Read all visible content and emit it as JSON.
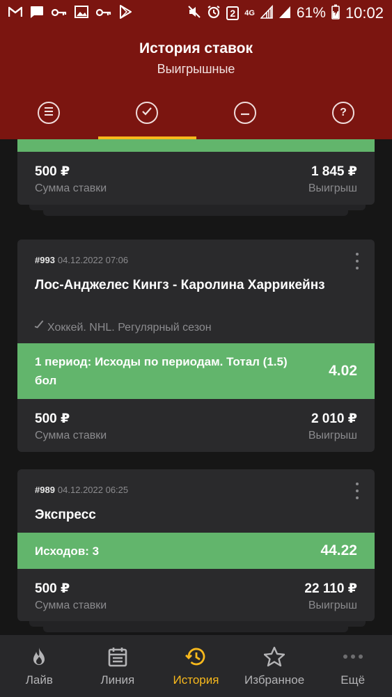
{
  "status_bar": {
    "battery": "61%",
    "time": "10:02",
    "notification_count": "2",
    "network": "4G"
  },
  "header": {
    "title": "История ставок",
    "subtitle": "Выигрышные"
  },
  "filter_tabs": [
    {
      "icon": "list-icon",
      "active": false
    },
    {
      "icon": "check-circle-icon",
      "active": true
    },
    {
      "icon": "minus-circle-icon",
      "active": false
    },
    {
      "icon": "question-circle-icon",
      "active": false
    }
  ],
  "cards": [
    {
      "amount": "500 ₽",
      "amount_label": "Сумма ставки",
      "win": "1 845 ₽",
      "win_label": "Выигрыш"
    },
    {
      "id": "#993",
      "date": "04.12.2022 07:06",
      "match": "Лос-Анджелес Кингз - Каролина Харрикейнз",
      "sport": "Хоккей. NHL. Регулярный сезон",
      "market": "1 период: Исходы по периодам. Тотал (1.5) бол",
      "odds": "4.02",
      "amount": "500 ₽",
      "amount_label": "Сумма ставки",
      "win": "2 010 ₽",
      "win_label": "Выигрыш"
    },
    {
      "id": "#989",
      "date": "04.12.2022 06:25",
      "match": "Экспресс",
      "market": "Исходов: 3",
      "odds": "44.22",
      "amount": "500 ₽",
      "amount_label": "Сумма ставки",
      "win": "22 110 ₽",
      "win_label": "Выигрыш"
    }
  ],
  "bottom_nav": [
    {
      "label": "Лайв",
      "icon": "flame-icon",
      "active": false
    },
    {
      "label": "Линия",
      "icon": "calendar-icon",
      "active": false
    },
    {
      "label": "История",
      "icon": "history-icon",
      "active": true
    },
    {
      "label": "Избранное",
      "icon": "star-icon",
      "active": false
    },
    {
      "label": "Ещё",
      "icon": "more-dots-icon",
      "active": false
    }
  ],
  "colors": {
    "header": "#7b1510",
    "accent": "#f8b91c",
    "win_green": "#62b56c",
    "card": "#2a2a2c",
    "background": "#161616"
  }
}
